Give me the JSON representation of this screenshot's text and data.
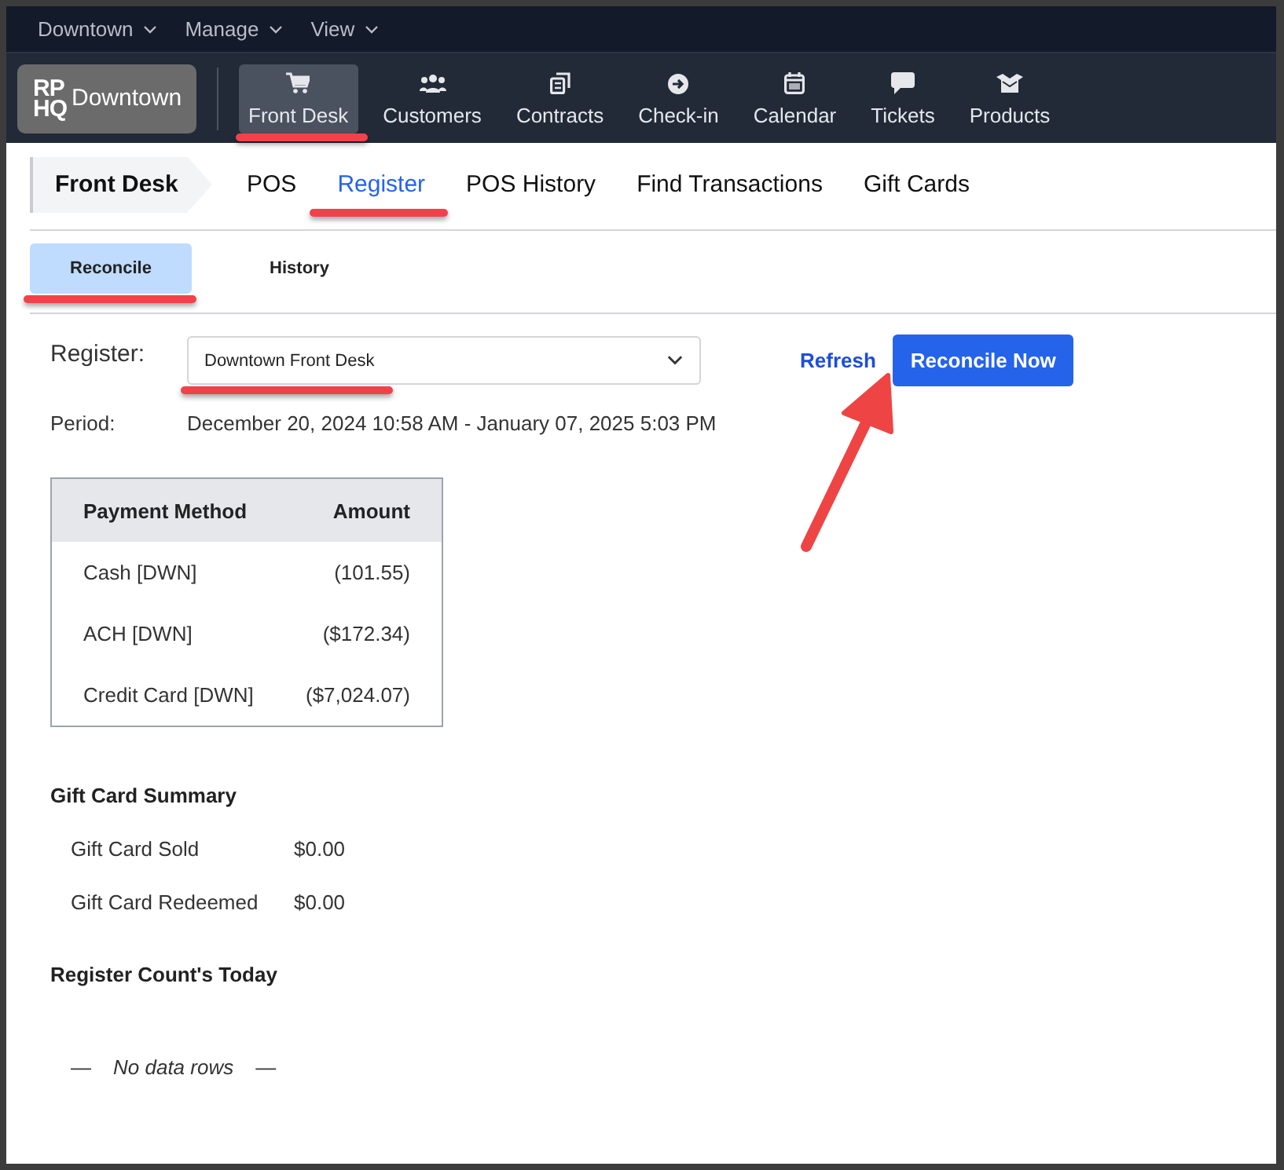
{
  "top_menu": [
    {
      "label": "Downtown"
    },
    {
      "label": "Manage"
    },
    {
      "label": "View"
    }
  ],
  "brand": {
    "logo_lines": [
      "RP",
      "HQ"
    ],
    "name": "Downtown"
  },
  "nav": [
    {
      "label": "Front Desk",
      "selected": true,
      "highlighted": true
    },
    {
      "label": "Customers",
      "selected": false,
      "highlighted": false
    },
    {
      "label": "Contracts",
      "selected": false,
      "highlighted": false
    },
    {
      "label": "Check-in",
      "selected": false,
      "highlighted": false
    },
    {
      "label": "Calendar",
      "selected": false,
      "highlighted": false
    },
    {
      "label": "Tickets",
      "selected": false,
      "highlighted": false
    },
    {
      "label": "Products",
      "selected": false,
      "highlighted": false
    }
  ],
  "section": {
    "title": "Front Desk",
    "tabs": [
      {
        "label": "POS",
        "selected": false,
        "highlighted": false
      },
      {
        "label": "Register",
        "selected": true,
        "highlighted": true
      },
      {
        "label": "POS History",
        "selected": false,
        "highlighted": false
      },
      {
        "label": "Find Transactions",
        "selected": false,
        "highlighted": false
      },
      {
        "label": "Gift Cards",
        "selected": false,
        "highlighted": false
      }
    ]
  },
  "sub_tabs": [
    {
      "label": "Reconcile",
      "selected": true,
      "highlighted": true
    },
    {
      "label": "History",
      "selected": false,
      "highlighted": false
    }
  ],
  "register": {
    "label": "Register:",
    "value": "Downtown Front Desk",
    "highlighted": true,
    "refresh": "Refresh",
    "action": "Reconcile Now",
    "action_arrow": true,
    "period_label": "Period:",
    "period": "December 20, 2024 10:58 AM - January 07, 2025 5:03 PM"
  },
  "payments": {
    "columns": [
      "Payment Method",
      "Amount"
    ],
    "rows": [
      {
        "method": "Cash [DWN]",
        "amount": "(101.55)"
      },
      {
        "method": "ACH [DWN]",
        "amount": "($172.34)"
      },
      {
        "method": "Credit Card [DWN]",
        "amount": "($7,024.07)"
      }
    ]
  },
  "gift_card_summary": {
    "title": "Gift Card Summary",
    "rows": [
      {
        "label": "Gift Card Sold",
        "amount": "$0.00"
      },
      {
        "label": "Gift Card Redeemed",
        "amount": "$0.00"
      }
    ]
  },
  "register_counts": {
    "title": "Register Count's Today",
    "empty": [
      "—",
      "No data rows",
      "—"
    ]
  }
}
